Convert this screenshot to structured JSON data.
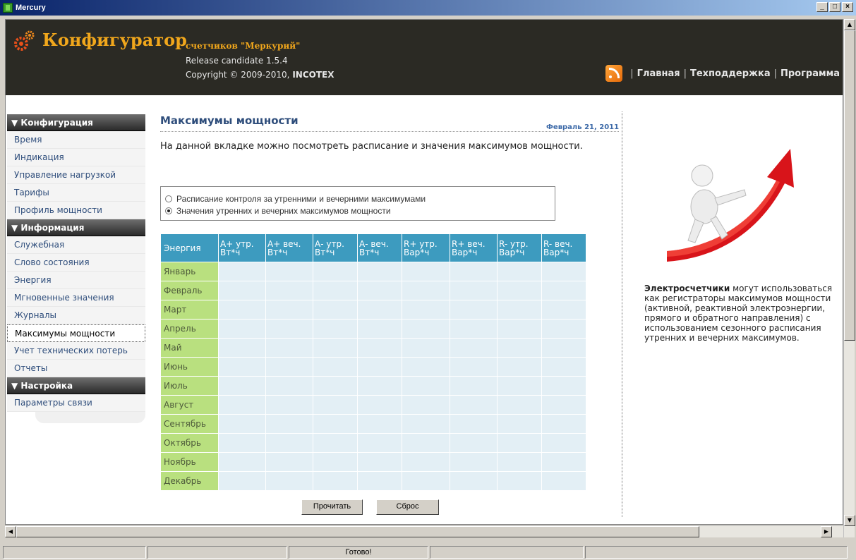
{
  "window": {
    "title": "Mercury",
    "controls": [
      "_",
      "□",
      "×"
    ]
  },
  "header": {
    "brand": "Конфигуратор",
    "brand_sub": "счетчиков \"Меркурий\"",
    "release": "Release candidate 1.5.4",
    "copyright_prefix": "Copyright © 2009-2010,",
    "company": "INCOTEX",
    "nav": [
      "Главная",
      "Техподдержка",
      "Программа"
    ]
  },
  "sidebar": {
    "sections": [
      {
        "title": "▼ Конфигурация",
        "items": [
          "Время",
          "Индикация",
          "Управление нагрузкой",
          "Тарифы",
          "Профиль мощности"
        ]
      },
      {
        "title": "▼ Информация",
        "items": [
          "Служебная",
          "Слово состояния",
          "Энергия",
          "Мгновенные значения",
          "Журналы",
          "Максимумы мощности",
          "Учет технических потерь",
          "Отчеты"
        ]
      },
      {
        "title": "▼ Настройка",
        "items": [
          "Параметры связи"
        ]
      }
    ],
    "active": "Максимумы мощности"
  },
  "main": {
    "title": "Максимумы мощности",
    "date": "Февраль 21, 2011",
    "intro": "На данной вкладке можно посмотреть расписание и значения максимумов мощности.",
    "radio_options": [
      {
        "label": "Расписание контроля за утренними и вечерними максимумами",
        "checked": false
      },
      {
        "label": "Значения утренних и вечерних максимумов мощности",
        "checked": true
      }
    ],
    "table": {
      "columns": [
        [
          "Энергия"
        ],
        [
          "А+ утр.",
          "Вт*ч"
        ],
        [
          "А+ веч.",
          "Вт*ч"
        ],
        [
          "А- утр.",
          "Вт*ч"
        ],
        [
          "А- веч.",
          "Вт*ч"
        ],
        [
          "R+ утр.",
          "Вар*ч"
        ],
        [
          "R+ веч.",
          "Вар*ч"
        ],
        [
          "R- утр.",
          "Вар*ч"
        ],
        [
          "R- веч.",
          "Вар*ч"
        ]
      ],
      "rows": [
        "Январь",
        "Февраль",
        "Март",
        "Апрель",
        "Май",
        "Июнь",
        "Июль",
        "Август",
        "Сентябрь",
        "Октябрь",
        "Ноябрь",
        "Декабрь"
      ]
    },
    "buttons": {
      "read": "Прочитать",
      "reset": "Сброс"
    }
  },
  "promo": {
    "bold": "Электросчетчики",
    "text": " могут использоваться как регистраторы максимумов мощности (активной, реактивной электроэнергии, прямого и обратного направления) с использованием сезонного расписания утренних и вечерних максимумов."
  },
  "status": {
    "text": "Готово!"
  },
  "colors": {
    "header_bg": "#2b2a24",
    "brand": "#f1a71c",
    "table_head": "#3d9bbf",
    "month_cell": "#b9e07f",
    "value_cell": "#e3eff5",
    "link": "#2e4d7b"
  }
}
